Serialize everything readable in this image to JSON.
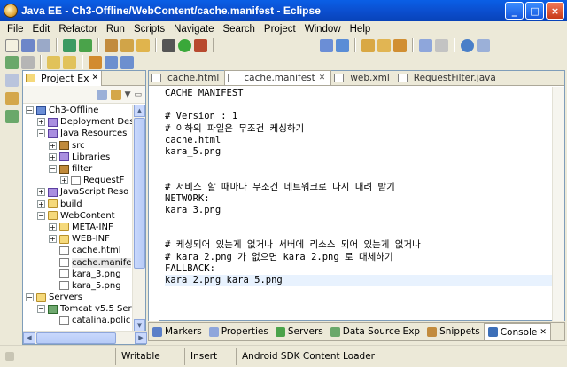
{
  "window": {
    "title": "Java EE - Ch3-Offline/WebContent/cache.manifest - Eclipse",
    "controls": [
      "_",
      "□",
      "×"
    ]
  },
  "menu": [
    "File",
    "Edit",
    "Refactor",
    "Run",
    "Scripts",
    "Navigate",
    "Search",
    "Project",
    "Window",
    "Help"
  ],
  "explorer": {
    "tab_label": "Project Ex",
    "tree": [
      {
        "label": "Ch3-Offline",
        "indent": 0,
        "toggle": "−",
        "icon": "proj"
      },
      {
        "label": "Deployment Des",
        "indent": 1,
        "toggle": "+",
        "icon": "lib"
      },
      {
        "label": "Java Resources",
        "indent": 1,
        "toggle": "−",
        "icon": "lib"
      },
      {
        "label": "src",
        "indent": 2,
        "toggle": "+",
        "icon": "pkg"
      },
      {
        "label": "Libraries",
        "indent": 2,
        "toggle": "+",
        "icon": "lib"
      },
      {
        "label": "filter",
        "indent": 2,
        "toggle": "−",
        "icon": "pkg"
      },
      {
        "label": "RequestF",
        "indent": 3,
        "toggle": "+",
        "icon": "file"
      },
      {
        "label": "JavaScript Reso",
        "indent": 1,
        "toggle": "+",
        "icon": "lib"
      },
      {
        "label": "build",
        "indent": 1,
        "toggle": "+",
        "icon": "folder"
      },
      {
        "label": "WebContent",
        "indent": 1,
        "toggle": "−",
        "icon": "folder"
      },
      {
        "label": "META-INF",
        "indent": 2,
        "toggle": "+",
        "icon": "folder"
      },
      {
        "label": "WEB-INF",
        "indent": 2,
        "toggle": "+",
        "icon": "folder"
      },
      {
        "label": "cache.html",
        "indent": 2,
        "toggle": "",
        "icon": "file"
      },
      {
        "label": "cache.manife",
        "indent": 2,
        "toggle": "",
        "icon": "file"
      },
      {
        "label": "kara_3.png",
        "indent": 2,
        "toggle": "",
        "icon": "file"
      },
      {
        "label": "kara_5.png",
        "indent": 2,
        "toggle": "",
        "icon": "file"
      },
      {
        "label": "Servers",
        "indent": 0,
        "toggle": "−",
        "icon": "folder"
      },
      {
        "label": "Tomcat v5.5 Ser",
        "indent": 1,
        "toggle": "−",
        "icon": "server"
      },
      {
        "label": "catalina.polic",
        "indent": 2,
        "toggle": "",
        "icon": "file"
      }
    ]
  },
  "editor": {
    "tabs": [
      {
        "label": "cache.html",
        "active": false
      },
      {
        "label": "cache.manifest",
        "active": true
      },
      {
        "label": "web.xml",
        "active": false
      },
      {
        "label": "RequestFilter.java",
        "active": false
      }
    ],
    "lines": [
      "CACHE MANIFEST",
      "",
      "# Version : 1",
      "# 이하의 파일은 무조건 케싱하기",
      "cache.html",
      "kara_5.png",
      "",
      "",
      "# 서비스 할 때마다 무조건 네트워크로 다시 내려 받기",
      "NETWORK:",
      "kara_3.png",
      "",
      "",
      "# 케싱되어 있는게 없거나 서버에 리소스 되어 있는게 없거나",
      "# kara_2.png 가 없으면 kara_2.png 로 대체하기",
      "FALLBACK:",
      "kara_2.png kara_5.png"
    ],
    "current_line": 16
  },
  "bottom_tabs": [
    {
      "label": "Markers",
      "active": false
    },
    {
      "label": "Properties",
      "active": false
    },
    {
      "label": "Servers",
      "active": false
    },
    {
      "label": "Data Source Exp",
      "active": false
    },
    {
      "label": "Snippets",
      "active": false
    },
    {
      "label": "Console",
      "active": true
    }
  ],
  "status": {
    "writable": "Writable",
    "insert": "Insert",
    "loader": "Android SDK Content Loader"
  }
}
